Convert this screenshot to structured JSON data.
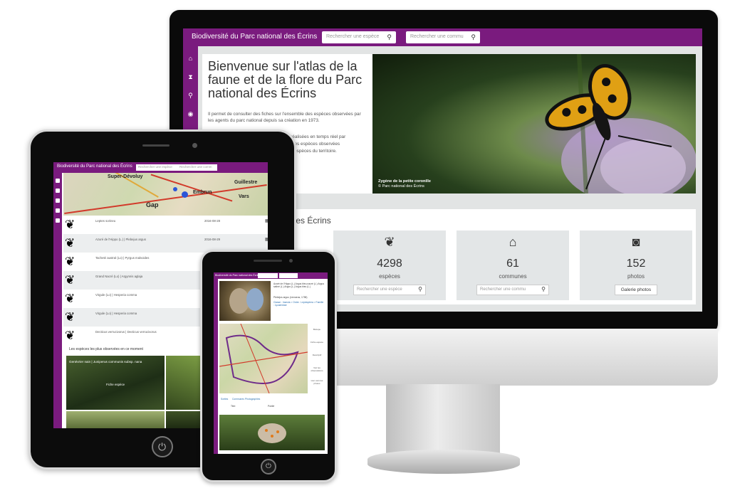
{
  "monitor": {
    "brand": "Biodiversité du Parc national des Écrins",
    "search_species_placeholder": "Rechercher une espèce",
    "search_commune_placeholder": "Rechercher une commu",
    "sidebar_icons": [
      "home-icon",
      "paperclip-icon",
      "search-icon",
      "camera-icon"
    ],
    "hero": {
      "title": "Bienvenue sur l'atlas de la faune et de la flore du Parc national des Écrins",
      "para1": "Il permet de consulter des fiches sur l'ensemble des espèces observées par les agents du parc national depuis sa création en 1973.",
      "para2": "rvations réalisées en temps réel par",
      "para3": "nsemble des espèces observées",
      "para4": "austif des espèces du territoire.",
      "caption": "Zygène de la petite coronille",
      "caption_credit": "© Parc national des Écrins"
    },
    "stats_title": "al des Écrins",
    "cards": [
      {
        "icon": "leaf-icon",
        "glyph": "❦",
        "value": "4298",
        "label": "espèces",
        "input_placeholder": "Rechercher une espèce"
      },
      {
        "icon": "town-hall-icon",
        "glyph": "⌂",
        "value": "61",
        "label": "communes",
        "input_placeholder": "Rechercher une commu"
      },
      {
        "icon": "camera-icon",
        "glyph": "◙",
        "value": "152",
        "label": "photos",
        "button": "Galerie photos"
      }
    ]
  },
  "tablet": {
    "brand": "Biodiversité du Parc national des Écrins",
    "search_species_placeholder": "Rechercher une espèce",
    "search_commune_placeholder": "Rechercher une comm",
    "map_places": [
      "Super-Dévoluy",
      "Embrun",
      "Guillestre",
      "Vars",
      "Gap"
    ],
    "observations": [
      {
        "name": "Leptes sorineu",
        "date": "2016-08-28"
      },
      {
        "name": "Azuré de l'Hippo (L.) | Plebejus argus",
        "date": "2016-08-29"
      },
      {
        "name": "Tacheté austral (Lo) | Pyrgus malvoides",
        "date": "2016-08-29"
      },
      {
        "name": "Grand Nacré (Lo) | Argynnis aglaja",
        "date": "2016"
      },
      {
        "name": "Virgule (Lo) | Hesperia comma",
        "date": "2016"
      },
      {
        "name": "Virgule (Lo) | Hesperia comma",
        "date": "2016"
      },
      {
        "name": "Decticus verrucivorus | Decticus verrucivorus",
        "date": "2016"
      }
    ],
    "section_title": "Les espèces les plus observées en ce moment",
    "photo_caption": "Genévrier nain | Juniperus communis subsp. nana",
    "photo_sub": "Fiche espèce"
  },
  "phone": {
    "brand": "Biodiversité du Parc national des Écrins",
    "species_text": "Azuré de l'Hippo (L.) Argus bleu-nacré (L.) Argus satiné (L.) Argus (L.) Argus bleu (L.)",
    "species_latin": "Plebejus argus (Linnaeus, 1758)",
    "species_group": "Classe : Insecta > Ordre : Lepidoptera > Famille : Lycaenidae",
    "tools": [
      "Biotope",
      "Fiche espèce",
      "Descriptif",
      "Voir les observations",
      "Lien vers les photos"
    ],
    "tabs": [
      "Sorties",
      "Communes",
      "Photographies"
    ],
    "tab_cols": [
      "Titre",
      "Publié"
    ]
  },
  "colors": {
    "purple": "#7a1b7e",
    "panel": "#e3e6e7"
  }
}
